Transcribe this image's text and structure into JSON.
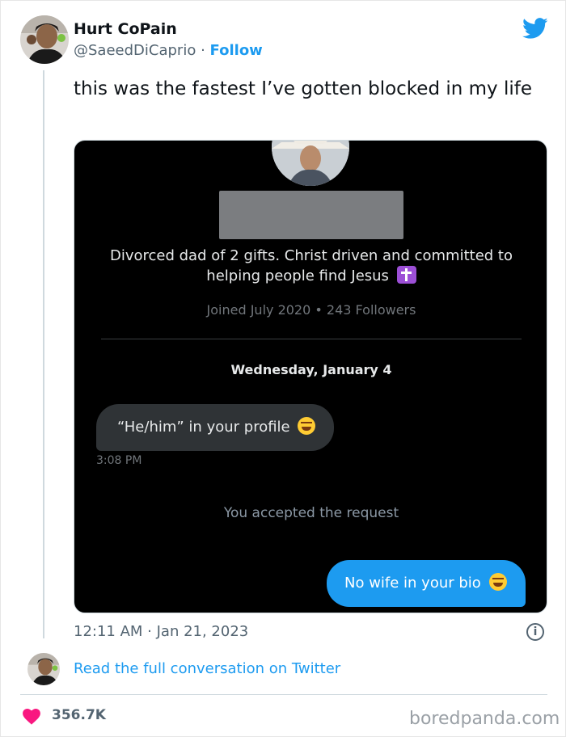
{
  "tweet": {
    "author_name": "Hurt CoPain",
    "author_handle": "@SaeedDiCaprio",
    "separator": "·",
    "follow_label": "Follow",
    "text": "this was the fastest I’ve gotten blocked in my life",
    "timestamp": "12:11 AM · Jan 21, 2023",
    "info_glyph": "i",
    "read_more_label": "Read the full conversation on Twitter",
    "like_count": "356.7K",
    "brand_color": "#1d9bf0",
    "like_color": "#f91880",
    "icons": [
      "twitter-bird-icon",
      "info-icon",
      "heart-icon"
    ]
  },
  "screenshot": {
    "bio": "Divorced dad of 2 gifts. Christ driven and committed to helping people find Jesus",
    "joined": "Joined July 2020 • 243 Followers",
    "date_separator": "Wednesday, January 4",
    "incoming_message": "“He/him” in your profile",
    "incoming_time": "3:08 PM",
    "system_message": "You accepted the request",
    "outgoing_message": "No wife in your bio"
  },
  "watermark": "boredpanda.com"
}
